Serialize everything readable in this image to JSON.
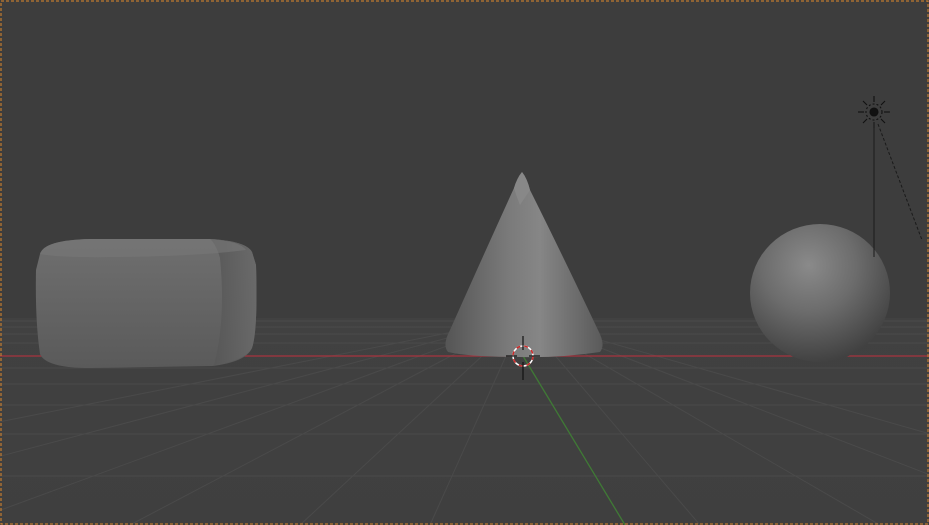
{
  "viewport": {
    "background_color": "#3d3d3d",
    "floor_color": "#404040",
    "grid_line_color": "#4b4b4b",
    "x_axis_color": "#a8343f",
    "y_axis_color": "#3f7a35",
    "active_border_color": "#e0892b",
    "object_color": "#6a6a6a"
  },
  "objects": [
    {
      "name": "box",
      "shape": "rounded-box"
    },
    {
      "name": "cone",
      "shape": "cone"
    },
    {
      "name": "sphere",
      "shape": "sphere"
    }
  ],
  "icons": {
    "light": "sun-lamp-icon",
    "cursor": "3d-cursor-icon"
  }
}
